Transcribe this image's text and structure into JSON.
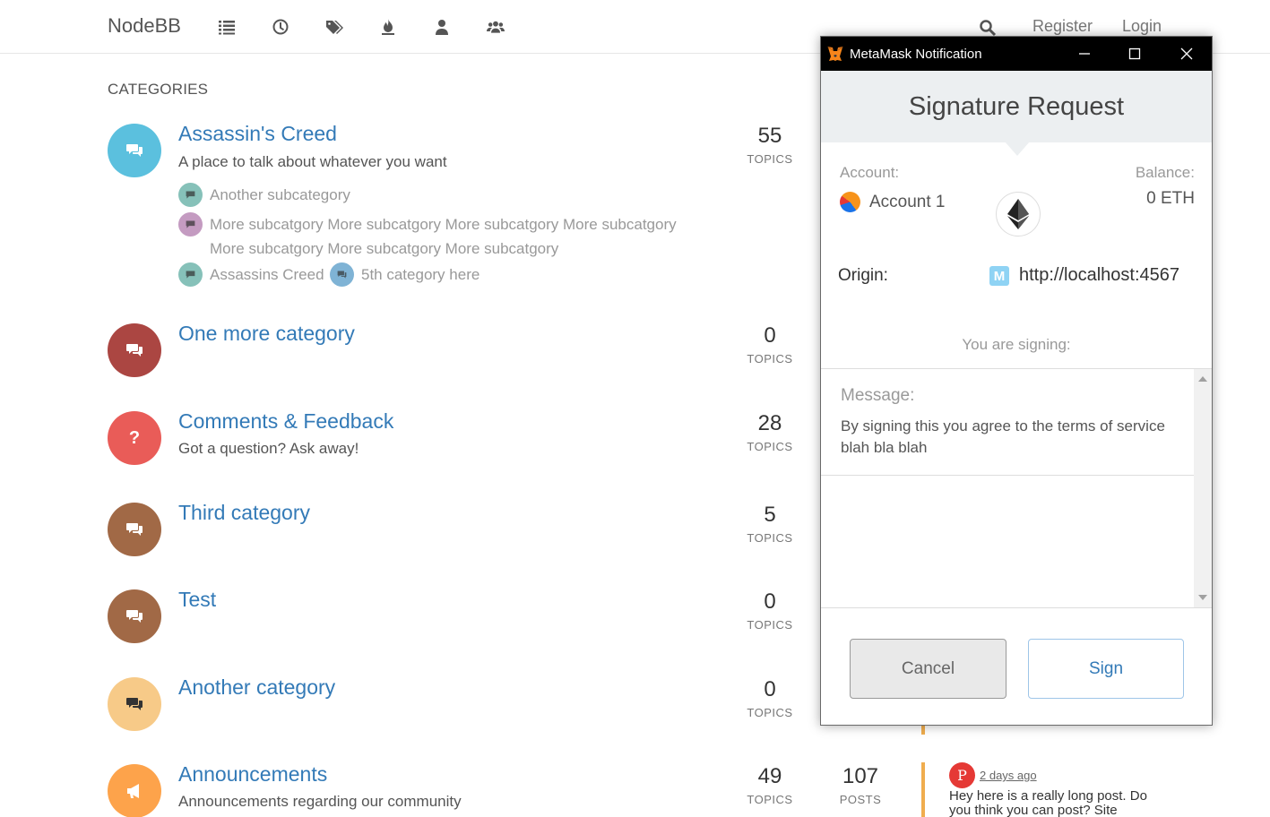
{
  "header": {
    "brand": "NodeBB",
    "nav_icons": [
      "list-icon",
      "clock-icon",
      "tags-icon",
      "fire-icon",
      "user-icon",
      "users-icon"
    ],
    "search_icon": "search-icon",
    "register": "Register",
    "login": "Login"
  },
  "categories_heading": "CATEGORIES",
  "categories": [
    {
      "title": "Assassin's Creed",
      "description": "A place to talk about whatever you want",
      "topics": "55",
      "topics_label": "TOPICS",
      "color": "#5bc0de",
      "subcategories": [
        {
          "label": "Another subcategory",
          "color": "#86c1b9"
        },
        {
          "label": "More subcatgory More subcatgory More subcatgory More subcatgory",
          "label2": "More subcatgory More subcatgory More subcatgory",
          "color": "#c49bc1"
        },
        {
          "label": "Assassins Creed",
          "color": "#86c1b9"
        },
        {
          "label": "5th category here",
          "color": "#7fb3d5"
        }
      ]
    },
    {
      "title": "One more category",
      "description": "",
      "topics": "0",
      "topics_label": "TOPICS",
      "color": "#ab4642"
    },
    {
      "title": "Comments & Feedback",
      "description": "Got a question? Ask away!",
      "topics": "28",
      "topics_label": "TOPICS",
      "color": "#e95c58",
      "icon_text": "?"
    },
    {
      "title": "Third category",
      "description": "",
      "topics": "5",
      "topics_label": "TOPICS",
      "color": "#a16946"
    },
    {
      "title": "Test",
      "description": "",
      "topics": "0",
      "topics_label": "TOPICS",
      "color": "#a16946"
    },
    {
      "title": "Another category",
      "description": "",
      "topics": "0",
      "topics_label": "TOPICS",
      "color": "#f7ca88"
    },
    {
      "title": "Announcements",
      "description": "Announcements regarding our community",
      "topics": "49",
      "topics_label": "TOPICS",
      "posts": "107",
      "posts_label": "POSTS",
      "color": "#fda34b"
    }
  ],
  "last_post": {
    "avatar_letter": "P",
    "time": "2 days ago",
    "text": "Hey here is a really long post. Do you think you can post? Site"
  },
  "metamask": {
    "window_title": "MetaMask Notification",
    "heading": "Signature Request",
    "account_label": "Account:",
    "account_name": "Account 1",
    "balance_label": "Balance:",
    "balance_value": "0 ETH",
    "origin_label": "Origin:",
    "origin_icon_letter": "M",
    "origin_url": "http://localhost:4567",
    "signing_label": "You are signing:",
    "message_label": "Message:",
    "message_text": "By signing this you agree to the terms of service blah bla blah",
    "cancel": "Cancel",
    "sign": "Sign"
  }
}
